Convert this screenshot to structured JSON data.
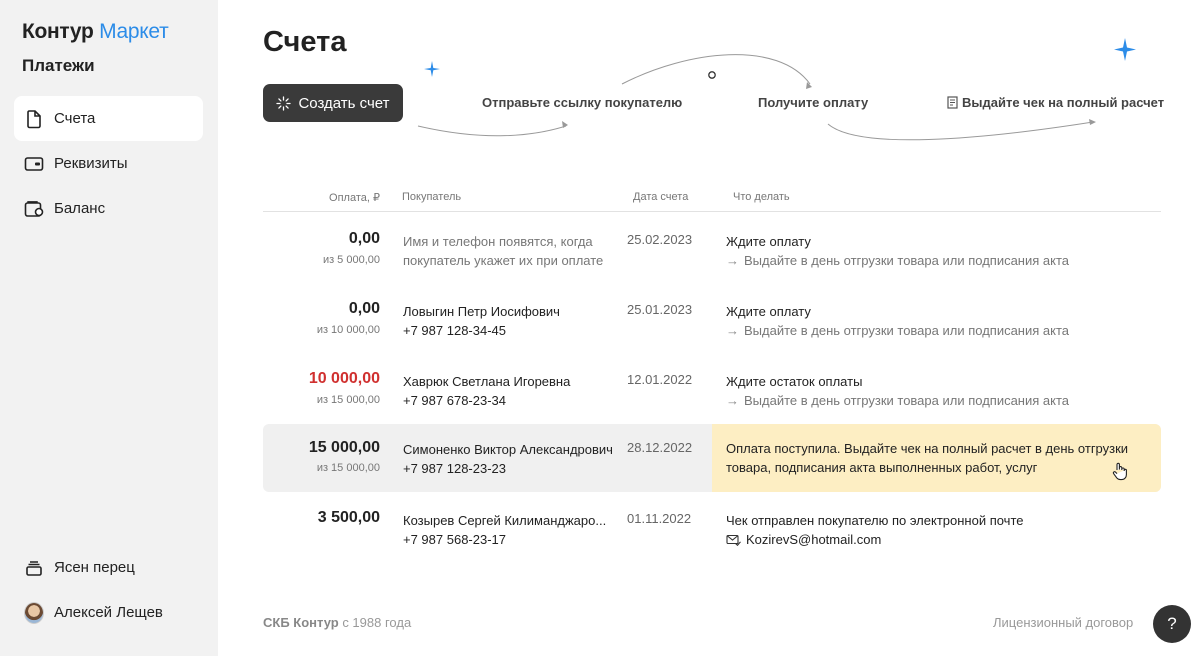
{
  "app": {
    "brand_main": "Контур",
    "brand_accent": "Маркет",
    "section": "Платежи",
    "accent_color": "#2c8ce8"
  },
  "sidebar": {
    "items": [
      {
        "label": "Счета",
        "icon": "document-icon",
        "active": true
      },
      {
        "label": "Реквизиты",
        "icon": "wallet-card-icon",
        "active": false
      },
      {
        "label": "Баланс",
        "icon": "wallet-icon",
        "active": false
      }
    ],
    "bottom": [
      {
        "label": "Ясен перец",
        "icon": "stack-icon"
      },
      {
        "label": "Алексей Лещев",
        "icon": "avatar"
      }
    ]
  },
  "page": {
    "title": "Счета",
    "create_button": "Создать счет",
    "steps": [
      "Отправьте ссылку покупателю",
      "Получите оплату",
      "Выдайте чек на полный расчет"
    ]
  },
  "table": {
    "headers": {
      "amount": "Оплата, ₽",
      "buyer": "Покупатель",
      "date": "Дата счета",
      "todo": "Что делать"
    },
    "rows": [
      {
        "amount": "0,00",
        "of": "из 5 000,00",
        "buyer_line1": "Имя и телефон появятся, когда",
        "buyer_line2": "покупатель укажет их при оплате",
        "date": "25.02.2023",
        "todo": "Ждите оплату",
        "todo_sub": "Выдайте в день отгрузки товара или подписания акта"
      },
      {
        "amount": "0,00",
        "of": "из 10 000,00",
        "buyer_line1": "Ловыгин Петр Иосифович",
        "buyer_line2": "+7 987 128-34-45",
        "date": "25.01.2023",
        "todo": "Ждите оплату",
        "todo_sub": "Выдайте в день отгрузки товара или подписания акта"
      },
      {
        "amount": "10 000,00",
        "of": "из 15 000,00",
        "buyer_line1": "Хаврюк Светлана Игоревна",
        "buyer_line2": "+7 987 678-23-34",
        "date": "12.01.2022",
        "todo": "Ждите остаток оплаты",
        "todo_sub": "Выдайте в день отгрузки товара или подписания акта"
      },
      {
        "amount": "15 000,00",
        "of": "из 15 000,00",
        "buyer_line1": "Симоненко Виктор Александрович",
        "buyer_line2": "+7 987 128-23-23",
        "date": "28.12.2022",
        "todo": "Оплата поступила. Выдайте чек на полный расчет в день отгрузки товара, подписания акта выполненных работ, услуг"
      },
      {
        "amount": "3 500,00",
        "of": "",
        "buyer_line1": "Козырев Сергей Килиманджаро...",
        "buyer_line2": "+7 987 568-23-17",
        "date": "01.11.2022",
        "todo": "Чек отправлен покупателю по электронной почте",
        "todo_sub": "KozirevS@hotmail.com"
      }
    ]
  },
  "footer": {
    "company": "СКБ Контур",
    "since": " с 1988 года",
    "license": "Лицензионный договор",
    "help": "?"
  }
}
